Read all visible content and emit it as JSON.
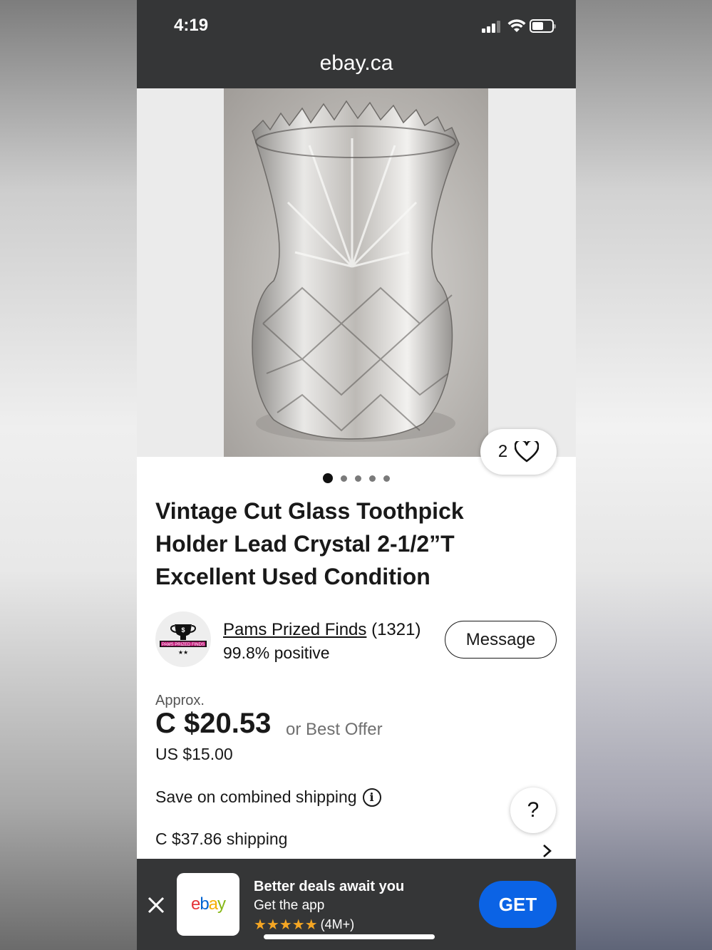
{
  "status_bar": {
    "time": "4:19"
  },
  "browser": {
    "url": "ebay.ca"
  },
  "gallery": {
    "watch_count": "2",
    "image_count": 5,
    "active_index": 0
  },
  "listing": {
    "title": "Vintage Cut Glass Toothpick Holder Lead Crystal 2-1/2”T Excellent Used Condition"
  },
  "seller": {
    "name": "Pams Prized Finds",
    "feedback_count": "(1321)",
    "positive": "99.8% positive",
    "logo_text": "PAMS PRIZED FINDS",
    "message_label": "Message"
  },
  "pricing": {
    "approx_label": "Approx.",
    "price": "C $20.53",
    "best_offer": "or Best Offer",
    "usd_price": "US $15.00",
    "combined_shipping": "Save on combined shipping",
    "shipping": "C $37.86 shipping"
  },
  "help": {
    "label": "?"
  },
  "app_banner": {
    "logo": "ebay",
    "title": "Better deals await you",
    "subtitle": "Get the app",
    "stars": "★★★★★",
    "rating_count": "(4M+)",
    "get_label": "GET"
  },
  "colors": {
    "status_bg": "#353637",
    "accent_blue": "#0b63e5",
    "star_color": "#f5a623",
    "text_primary": "#191919",
    "text_muted": "#707070"
  }
}
